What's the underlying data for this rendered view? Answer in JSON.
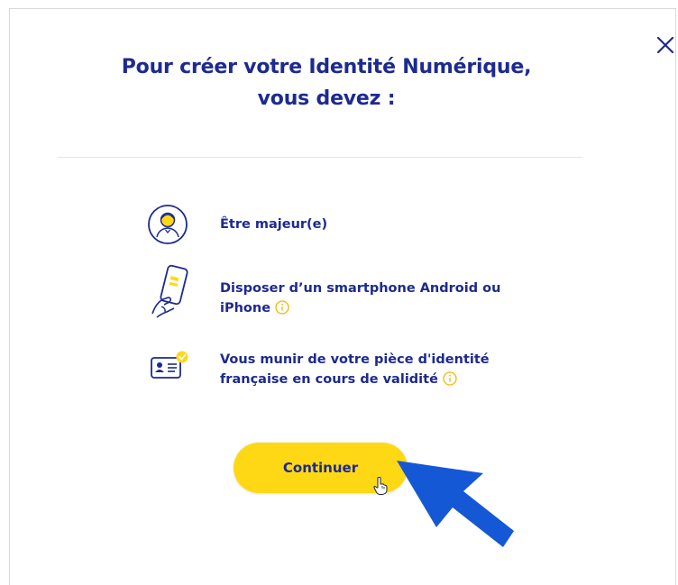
{
  "dialog": {
    "title_line1": "Pour créer votre Identité Numérique,",
    "title_line2": "vous devez :"
  },
  "requirements": [
    {
      "icon": "adult-person-icon",
      "text_line1": "Être majeur(e)"
    },
    {
      "icon": "smartphone-hand-icon",
      "text_line1": "Disposer d’un smartphone Android ou",
      "text_line2": "iPhone"
    },
    {
      "icon": "id-card-check-icon",
      "text_line1": "Vous munir de votre pièce d'identité",
      "text_line2": "française en cours de validité"
    }
  ],
  "actions": {
    "continue_label": "Continuer"
  },
  "colors": {
    "primary": "#1d2a8f",
    "accent_yellow": "#ffd815",
    "info_yellow": "#f2b705",
    "annotation_arrow": "#1558d6"
  }
}
